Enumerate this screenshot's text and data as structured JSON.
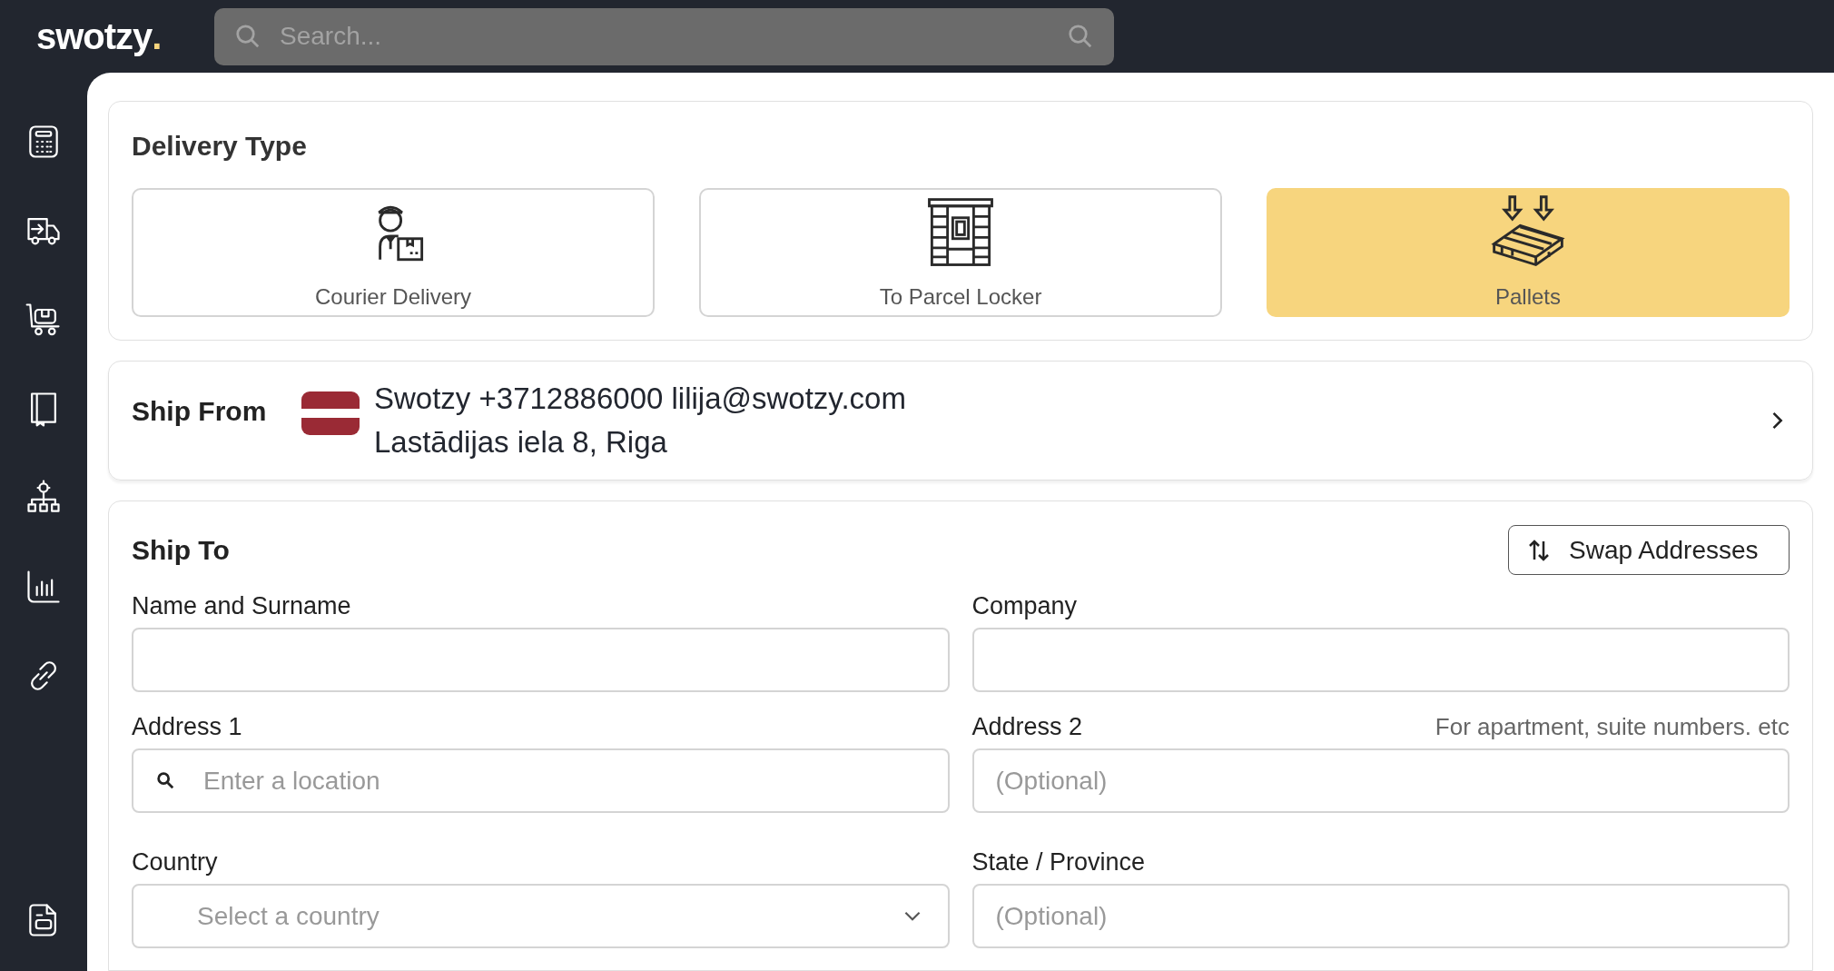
{
  "logo": {
    "text": "swotzy",
    "dot": "."
  },
  "search": {
    "placeholder": "Search..."
  },
  "sidebar": {
    "items": [
      {
        "kind": "calculator"
      },
      {
        "kind": "truck"
      },
      {
        "kind": "cart"
      },
      {
        "kind": "book"
      },
      {
        "kind": "network"
      },
      {
        "kind": "chart"
      },
      {
        "kind": "link"
      }
    ],
    "footer": {
      "kind": "document"
    }
  },
  "delivery_type": {
    "title": "Delivery Type",
    "options": [
      {
        "kind": "courier",
        "label": "Courier Delivery",
        "selected": false
      },
      {
        "kind": "locker",
        "label": "To Parcel Locker",
        "selected": false
      },
      {
        "kind": "pallet",
        "label": "Pallets",
        "selected": true
      }
    ]
  },
  "ship_from": {
    "title": "Ship From",
    "line_1": "Swotzy +3712886000 lilija@swotzy.com",
    "line_2": "Lastādijas iela 8, Riga"
  },
  "ship_to": {
    "title": "Ship To",
    "swap_button": "Swap Addresses",
    "fields": [
      {
        "kind": "text",
        "label": "Name and Surname"
      },
      {
        "kind": "text",
        "label": "Company"
      },
      {
        "kind": "search",
        "label": "Address 1",
        "placeholder": "Enter a location"
      },
      {
        "kind": "text",
        "label": "Address 2",
        "hint": "For apartment, suite numbers. etc",
        "placeholder": "(Optional)"
      },
      {
        "kind": "select",
        "label": "Country",
        "placeholder": "Select a country"
      },
      {
        "kind": "text",
        "label": "State / Province",
        "placeholder": "(Optional)"
      }
    ]
  }
}
